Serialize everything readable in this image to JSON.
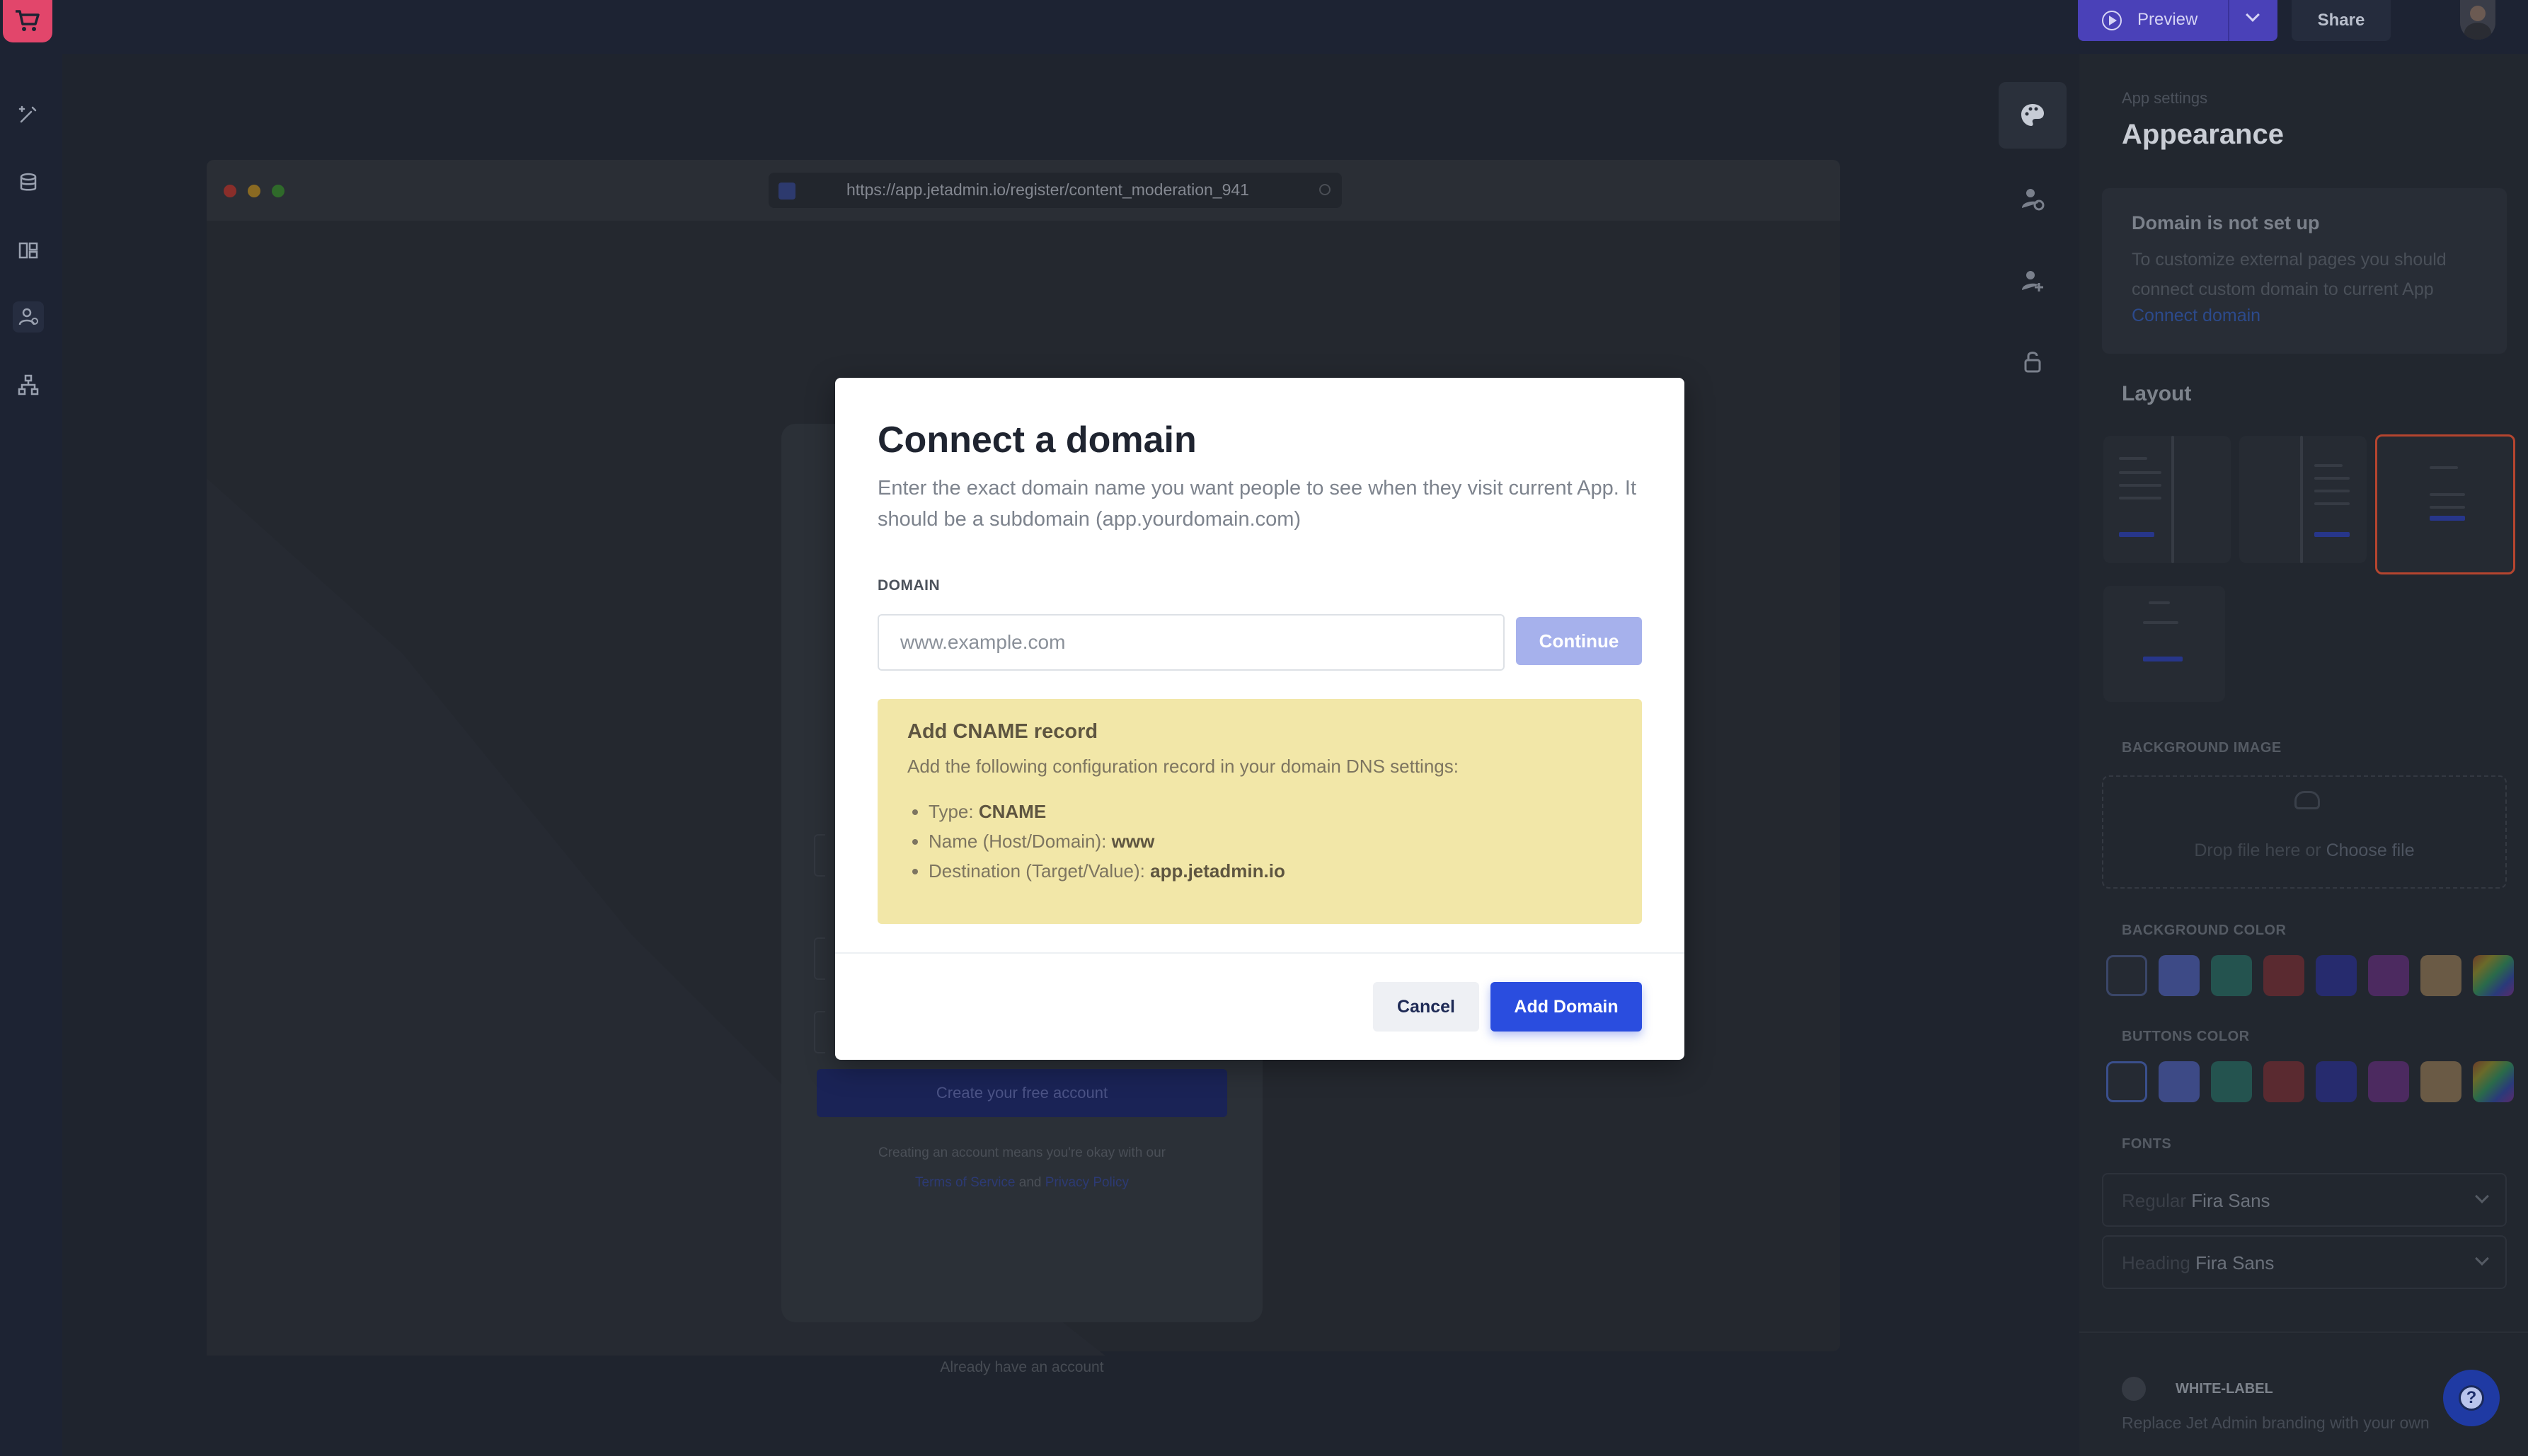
{
  "topbar": {
    "logo_icon": "cart-icon",
    "preview_label": "Preview",
    "share_label": "Share"
  },
  "left_rail": {
    "items": [
      "builder-icon",
      "database-icon",
      "pages-icon",
      "users-icon",
      "hierarchy-icon"
    ],
    "active": "users-icon"
  },
  "browser": {
    "url": "https://app.jetadmin.io/register/content_moderation_941",
    "register_button": "Create your free account",
    "terms_prefix": "Creating an account means you're okay with our",
    "terms_link": "Terms of Service",
    "and_text": "and",
    "privacy_link": "Privacy Policy",
    "already_text": "Already have an account"
  },
  "right_rail": {
    "items": [
      "palette-icon",
      "user-settings-icon",
      "user-add-icon",
      "lock-icon"
    ],
    "active": "palette-icon"
  },
  "settings": {
    "subtitle": "App settings",
    "title": "Appearance",
    "domain_box": {
      "heading": "Domain is not set up",
      "text": "To customize external pages you should connect custom domain to current App",
      "link": "Connect domain"
    },
    "layout_heading": "Layout",
    "background_image_label": "BACKGROUND IMAGE",
    "upload_text": "Drop file here or",
    "upload_link": "Choose file",
    "background_color_label": "BACKGROUND COLOR",
    "buttons_color_label": "BUTTONS COLOR",
    "swatch_colors": [
      "#252a33",
      "#3d4a86",
      "#24534f",
      "#5a2a30",
      "#262b6e",
      "#4c2a60",
      "#6a5a45",
      "multicolor"
    ],
    "fonts_label": "FONTS",
    "font_regular_key": "Regular",
    "font_regular_value": "Fira Sans",
    "font_heading_key": "Heading",
    "font_heading_value": "Fira Sans",
    "white_label": "WHITE-LABEL",
    "white_label_text": "Replace Jet Admin branding with your own"
  },
  "modal": {
    "title": "Connect a domain",
    "description": "Enter the exact domain name you want people to see when they visit current App. It should be a subdomain (app.yourdomain.com)",
    "domain_label": "DOMAIN",
    "domain_placeholder": "www.example.com",
    "domain_value": "",
    "continue_label": "Continue",
    "cname": {
      "heading": "Add CNAME record",
      "text": "Add the following configuration record in your domain DNS settings:",
      "type_key": "Type:",
      "type_value": "CNAME",
      "name_key": "Name (Host/Domain):",
      "name_value": "www",
      "dest_key": "Destination (Target/Value):",
      "dest_value": "app.jetadmin.io"
    },
    "cancel_label": "Cancel",
    "add_label": "Add Domain"
  },
  "help_icon": "help-icon"
}
